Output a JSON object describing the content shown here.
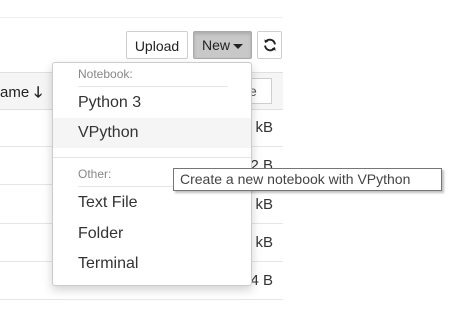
{
  "toolbar": {
    "upload_label": "Upload",
    "new_label": "New",
    "refresh_icon": "refresh-icon"
  },
  "file_list": {
    "name_header": "ame",
    "sort_icon": "arrow-down-icon",
    "size_input_value": "e",
    "row_sizes": [
      "kB",
      "2 B",
      "kB",
      "kB",
      "1.4 B",
      ""
    ]
  },
  "new_menu": {
    "notebook_header": "Notebook:",
    "notebook_items": [
      "Python 3",
      "VPython"
    ],
    "other_header": "Other:",
    "other_items": [
      "Text File",
      "Folder",
      "Terminal"
    ]
  },
  "tooltip": {
    "text": "Create a new notebook with VPython"
  }
}
